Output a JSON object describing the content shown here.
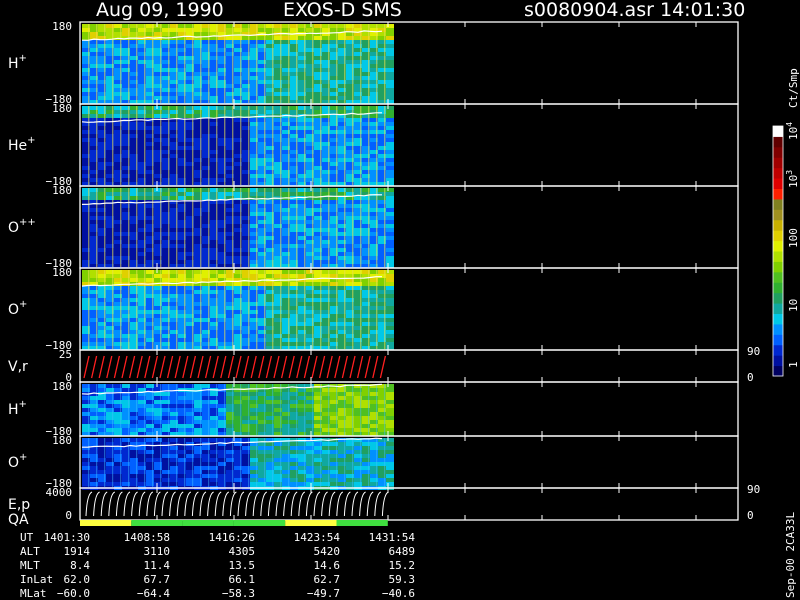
{
  "header": {
    "date": "Aug 09, 1990",
    "instrument": "EXOS-D SMS",
    "filename": "s0080904.asr",
    "time": "14:01:30"
  },
  "colorbar": {
    "unit": "Ct/Smp",
    "labels": [
      "1",
      "10",
      "100",
      "10",
      "10"
    ],
    "label_exponents": [
      "",
      "",
      "",
      "3",
      "4"
    ],
    "scale": "log",
    "colors": [
      "#000060",
      "#0010a0",
      "#0028d0",
      "#0060ff",
      "#0090ff",
      "#00c8e8",
      "#10a8a0",
      "#20a060",
      "#30b030",
      "#50c020",
      "#80d000",
      "#b0e000",
      "#e0f000",
      "#e0d000",
      "#c8b000",
      "#a09020",
      "#808020",
      "#ff2000",
      "#e00000",
      "#c00000",
      "#a00000",
      "#800000",
      "#600000",
      "#ffffff"
    ]
  },
  "panels": [
    {
      "name": "H",
      "charge": "+",
      "ymax": "180",
      "ymin": "−180",
      "kind": "angle-upper"
    },
    {
      "name": "He",
      "charge": "+",
      "ymax": "180",
      "ymin": "−180",
      "kind": "angle-lowfill"
    },
    {
      "name": "O",
      "charge": "++",
      "ymax": "180",
      "ymin": "−180",
      "kind": "angle-lowfill"
    },
    {
      "name": "O",
      "charge": "+",
      "ymax": "180",
      "ymin": "−180",
      "kind": "angle-upper"
    },
    {
      "name": "V",
      "charge": "",
      "suffix": ",r",
      "ymax": "25",
      "ymin": "0",
      "right_top": "90",
      "right_bottom": "0",
      "kind": "vr"
    },
    {
      "name": "H",
      "charge": "+",
      "ymax": "180",
      "ymin": "−180",
      "kind": "energy-h"
    },
    {
      "name": "O",
      "charge": "+",
      "ymax": "180",
      "ymin": "−180",
      "kind": "energy-o"
    },
    {
      "name": "E",
      "charge": "",
      "suffix": ",p",
      "ymax": "4000",
      "ymin": "0",
      "right_top": "90",
      "right_bottom": "0",
      "kind": "ep"
    }
  ],
  "qa_label": "QA",
  "table": {
    "rows": [
      {
        "label": "UT",
        "values": [
          "1401:30",
          "1408:58",
          "1416:26",
          "1423:54",
          "1431:54"
        ]
      },
      {
        "label": "ALT",
        "values": [
          "1914",
          "3110",
          "4305",
          "5420",
          "6489"
        ]
      },
      {
        "label": "MLT",
        "values": [
          "8.4",
          "11.4",
          "13.5",
          "14.6",
          "15.2"
        ]
      },
      {
        "label": "InLat",
        "values": [
          "62.0",
          "67.7",
          "66.1",
          "62.7",
          "59.3"
        ]
      },
      {
        "label": "MLat",
        "values": [
          "−60.0",
          "−64.4",
          "−58.3",
          "−49.7",
          "−40.6"
        ]
      }
    ]
  },
  "version_stamp": "Sep-00 2CA33L"
}
